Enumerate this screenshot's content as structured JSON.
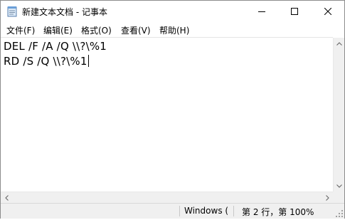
{
  "window": {
    "title": "新建文本文档 - 记事本"
  },
  "caption_buttons": {
    "minimize_icon": "minimize-icon",
    "maximize_icon": "maximize-icon",
    "close_icon": "close-icon"
  },
  "menu": {
    "items": [
      {
        "label": "文件(F)"
      },
      {
        "label": "编辑(E)"
      },
      {
        "label": "格式(O)"
      },
      {
        "label": "查看(V)"
      },
      {
        "label": "帮助(H)"
      }
    ]
  },
  "editor": {
    "lines": [
      "DEL /F /A /Q \\\\?\\%1",
      "RD /S /Q \\\\?\\%1"
    ]
  },
  "status": {
    "platform": "Windows (",
    "position": "第 2 行，第 100%"
  },
  "colors": {
    "statusbar_bg": "#f0f0f0",
    "window_bg": "#ffffff",
    "border": "#8c8c8c"
  }
}
